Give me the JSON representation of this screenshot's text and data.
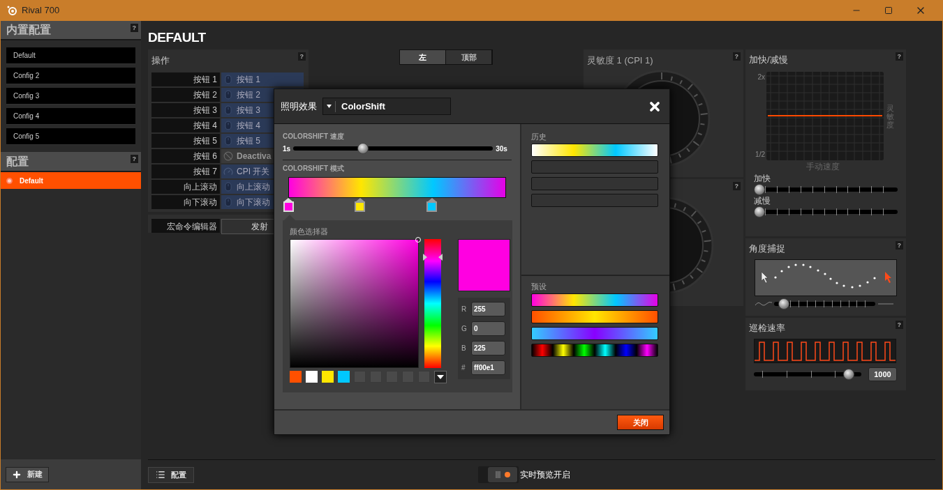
{
  "window": {
    "title": "Rival 700"
  },
  "sidebar": {
    "builtin_title": "内置配置",
    "builtin_help": "?",
    "builtin_configs": [
      {
        "label": "Default"
      },
      {
        "label": "Config 2"
      },
      {
        "label": "Config 3"
      },
      {
        "label": "Config 4"
      },
      {
        "label": "Config 5"
      }
    ],
    "configs_title": "配置",
    "configs_help": "?",
    "configs": [
      {
        "label": "Default",
        "selected": true
      }
    ],
    "new_button": "新建"
  },
  "page_title": "DEFAULT",
  "actions": {
    "title": "操作",
    "help": "?",
    "rows": [
      {
        "button": "按钮 1",
        "assignment": "按钮 1",
        "kind": "mouse"
      },
      {
        "button": "按钮 2",
        "assignment": "按钮 2",
        "kind": "mouse"
      },
      {
        "button": "按钮 3",
        "assignment": "按钮 3",
        "kind": "mouse"
      },
      {
        "button": "按钮 4",
        "assignment": "按钮 4",
        "kind": "mouse"
      },
      {
        "button": "按钮 5",
        "assignment": "按钮 5",
        "kind": "mouse"
      },
      {
        "button": "按钮 6",
        "assignment": "Deactiva",
        "kind": "disabled"
      },
      {
        "button": "按钮 7",
        "assignment": "CPI 开关",
        "kind": "cpi"
      },
      {
        "button": "向上滚动",
        "assignment": "向上滚动",
        "kind": "mouse"
      },
      {
        "button": "向下滚动",
        "assignment": "向下滚动",
        "kind": "mouse"
      }
    ],
    "macro_label": "宏命令编辑器",
    "macro_button": "发射"
  },
  "side_tabs": [
    {
      "label": "左",
      "selected": true
    },
    {
      "label": "顶部",
      "selected": false
    }
  ],
  "sensitivity": {
    "title": "灵敏度 1 (CPI 1)",
    "help": "?",
    "second_help": "?"
  },
  "acceleration": {
    "title": "加快/减慢",
    "help": "?",
    "y_top": "2x",
    "y_bottom": "1/2",
    "y_label": "灵敏度",
    "x_label": "手动速度",
    "sliders": [
      {
        "label": "加快",
        "level": 0
      },
      {
        "label": "减慢",
        "level": 0
      }
    ]
  },
  "angle_snapping": {
    "title": "角度捕捉",
    "help": "?",
    "level": 0.05
  },
  "polling": {
    "title": "巡检速率",
    "help": "?",
    "level": 0.93,
    "value": "1000"
  },
  "dialog": {
    "effect_label": "照明效果",
    "effect_value": "ColorShift",
    "speed_label": "COLORSHIFT 速度",
    "speed_min": "1s",
    "speed_max": "30s",
    "speed_slider": {
      "level": 0.34
    },
    "pattern_label": "COLORSHIFT 模式",
    "stops": [
      {
        "color": "#ff00e1",
        "selected": true
      },
      {
        "color": "#ffe600",
        "selected": false
      },
      {
        "color": "#00c8ff",
        "selected": false
      }
    ],
    "picker_label": "颜色选择器",
    "color": "#ff00e1",
    "swatches": [
      {
        "kind": "color",
        "color": "#ff5000"
      },
      {
        "kind": "color",
        "color": "#ffffff"
      },
      {
        "kind": "color",
        "color": "#ffe600"
      },
      {
        "kind": "color",
        "color": "#00c8ff"
      },
      {
        "kind": "empty"
      },
      {
        "kind": "empty"
      },
      {
        "kind": "empty"
      },
      {
        "kind": "empty"
      },
      {
        "kind": "empty"
      }
    ],
    "fields": [
      {
        "label": "R",
        "value": "255"
      },
      {
        "label": "G",
        "value": "0"
      },
      {
        "label": "B",
        "value": "225"
      },
      {
        "label": "#",
        "value": "ff00e1"
      }
    ],
    "history_label": "历史",
    "history": [
      {
        "kind": "pastel"
      },
      {
        "kind": "empty"
      },
      {
        "kind": "empty"
      },
      {
        "kind": "empty"
      }
    ],
    "presets_label": "预设",
    "presets": [
      {
        "kind": "rainbow"
      },
      {
        "kind": "fire"
      },
      {
        "kind": "ice"
      },
      {
        "kind": "spectrum"
      }
    ],
    "close_button": "关闭"
  },
  "bottom": {
    "config_button": "配置",
    "live_preview": {
      "label": "实时预览开启",
      "on": true
    }
  }
}
